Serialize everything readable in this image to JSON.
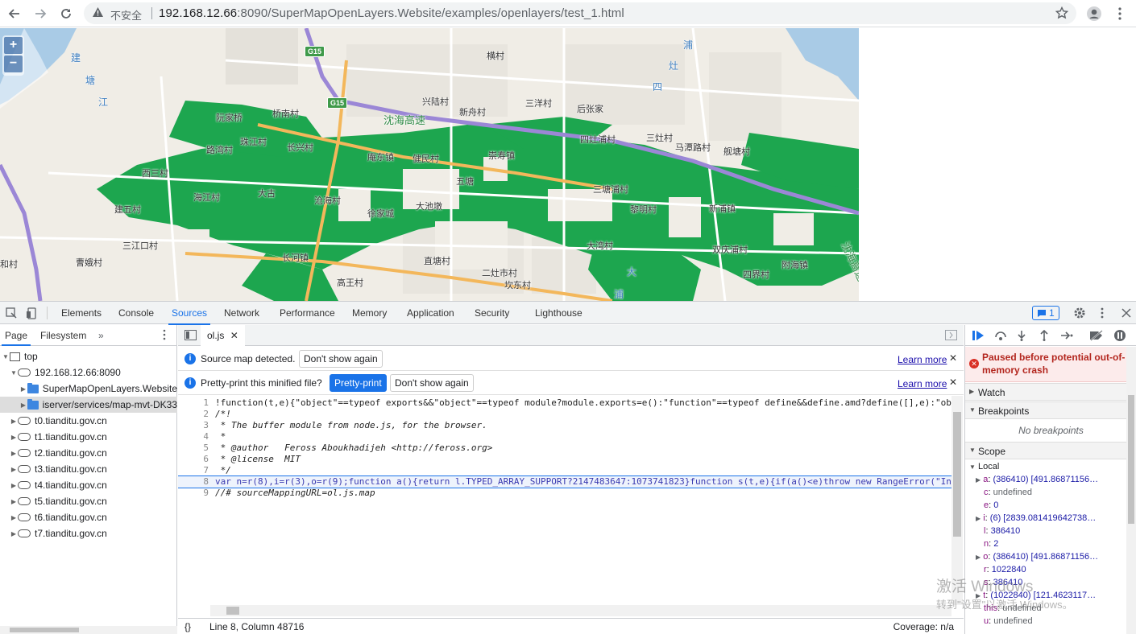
{
  "browser": {
    "security_label": "不安全",
    "url_host": "192.168.12.66",
    "url_rest": ":8090/SuperMapOpenLayers.Website/examples/openlayers/test_1.html",
    "icons": [
      "back-icon",
      "forward-icon",
      "reload-icon",
      "warning-icon",
      "star-icon",
      "profile-icon",
      "menu-icon"
    ]
  },
  "map": {
    "zoom_in": "+",
    "zoom_out": "−",
    "highway_label": "沈海高速",
    "highway_label_2": "沈海高速",
    "shields": [
      "G15",
      "G15"
    ],
    "water_labels": [
      "建",
      "塘",
      "江",
      "浦",
      "灶",
      "四",
      "大",
      "浦"
    ],
    "places": [
      "横村",
      "兴陆村",
      "新舟村",
      "三洋村",
      "后张家",
      "阮家桥",
      "桥南村",
      "珠江村",
      "路湾村",
      "长兴村",
      "庵东镇",
      "健民村",
      "崇寿镇",
      "四灶浦村",
      "三灶村",
      "马潭路村",
      "舰塘村",
      "西三村",
      "五塘",
      "大古",
      "沧海村",
      "海江村",
      "建五村",
      "徐家城",
      "大池墩",
      "三塘浦村",
      "黎明村",
      "新浦镇",
      "三江口村",
      "大湾村",
      "和村",
      "曹娥村",
      "长河镇",
      "直塘村",
      "二灶市村",
      "高王村",
      "坎东村",
      "双庆浦村",
      "附海镇",
      "四界村"
    ]
  },
  "devtools": {
    "tabs": [
      "Elements",
      "Console",
      "Sources",
      "Network",
      "Performance",
      "Memory",
      "Application",
      "Security",
      "Lighthouse"
    ],
    "active_tab": "Sources",
    "issues_count": "1",
    "navigator": {
      "tabs": [
        "Page",
        "Filesystem"
      ],
      "more": "»",
      "tree": [
        {
          "label": "top",
          "icon": "frame-icon",
          "indent": 0
        },
        {
          "label": "192.168.12.66:8090",
          "icon": "cloud-icon",
          "indent": 1
        },
        {
          "label": "SuperMapOpenLayers.Website",
          "icon": "folder-icon",
          "indent": 2
        },
        {
          "label": "iserver/services/map-mvt-DK33",
          "icon": "folder-icon",
          "indent": 2
        },
        {
          "label": "t0.tianditu.gov.cn",
          "icon": "cloud-icon",
          "indent": 1
        },
        {
          "label": "t1.tianditu.gov.cn",
          "icon": "cloud-icon",
          "indent": 1
        },
        {
          "label": "t2.tianditu.gov.cn",
          "icon": "cloud-icon",
          "indent": 1
        },
        {
          "label": "t3.tianditu.gov.cn",
          "icon": "cloud-icon",
          "indent": 1
        },
        {
          "label": "t4.tianditu.gov.cn",
          "icon": "cloud-icon",
          "indent": 1
        },
        {
          "label": "t5.tianditu.gov.cn",
          "icon": "cloud-icon",
          "indent": 1
        },
        {
          "label": "t6.tianditu.gov.cn",
          "icon": "cloud-icon",
          "indent": 1
        },
        {
          "label": "t7.tianditu.gov.cn",
          "icon": "cloud-icon",
          "indent": 1
        }
      ]
    },
    "editor": {
      "file_tab": "ol.js",
      "sourcemap_msg": "Source map detected.",
      "dont_show": "Don't show again",
      "learn_more": "Learn more",
      "prettyprint_msg": "Pretty-print this minified file?",
      "prettyprint_btn": "Pretty-print",
      "lines": [
        "!function(t,e){\"object\"==typeof exports&&\"object\"==typeof module?module.exports=e():\"function\"==typeof define&&define.amd?define([],e):\"ob",
        "/*!",
        " * The buffer module from node.js, for the browser.",
        " *",
        " * @author   Feross Aboukhadijeh <http://feross.org>",
        " * @license  MIT",
        " */",
        "var n=r(8),i=r(3),o=r(9);function a(){return l.TYPED_ARRAY_SUPPORT?2147483647:1073741823}function s(t,e){if(a()<e)throw new RangeError(\"In",
        "//# sourceMappingURL=ol.js.map"
      ],
      "status_position": "Line 8, Column 48716",
      "coverage": "Coverage: n/a",
      "braces": "{}"
    },
    "debugger": {
      "paused_msg": "Paused before potential out-of-memory crash",
      "watch": "Watch",
      "breakpoints": "Breakpoints",
      "no_breakpoints": "No breakpoints",
      "scope": "Scope",
      "local": "Local",
      "scope_items": [
        {
          "expand": true,
          "key": "a",
          "val": "(386410) [491.86871156…"
        },
        {
          "expand": false,
          "key": "c",
          "val": "undefined"
        },
        {
          "expand": false,
          "key": "e",
          "val": "0"
        },
        {
          "expand": true,
          "key": "i",
          "val": "(6) [2839.081419642738…"
        },
        {
          "expand": false,
          "key": "l",
          "val": "386410"
        },
        {
          "expand": false,
          "key": "n",
          "val": "2"
        },
        {
          "expand": true,
          "key": "o",
          "val": "(386410) [491.86871156…"
        },
        {
          "expand": false,
          "key": "r",
          "val": "1022840"
        },
        {
          "expand": false,
          "key": "s",
          "val": "386410"
        },
        {
          "expand": true,
          "key": "t",
          "val": "(1022840) [121.4623117…"
        },
        {
          "expand": false,
          "key": "this",
          "val": "undefined"
        },
        {
          "expand": false,
          "key": "u",
          "val": "undefined"
        }
      ]
    }
  },
  "watermark": {
    "line1": "激活 Windows",
    "line2": "转到\"设置\"以激活 Windows。"
  }
}
